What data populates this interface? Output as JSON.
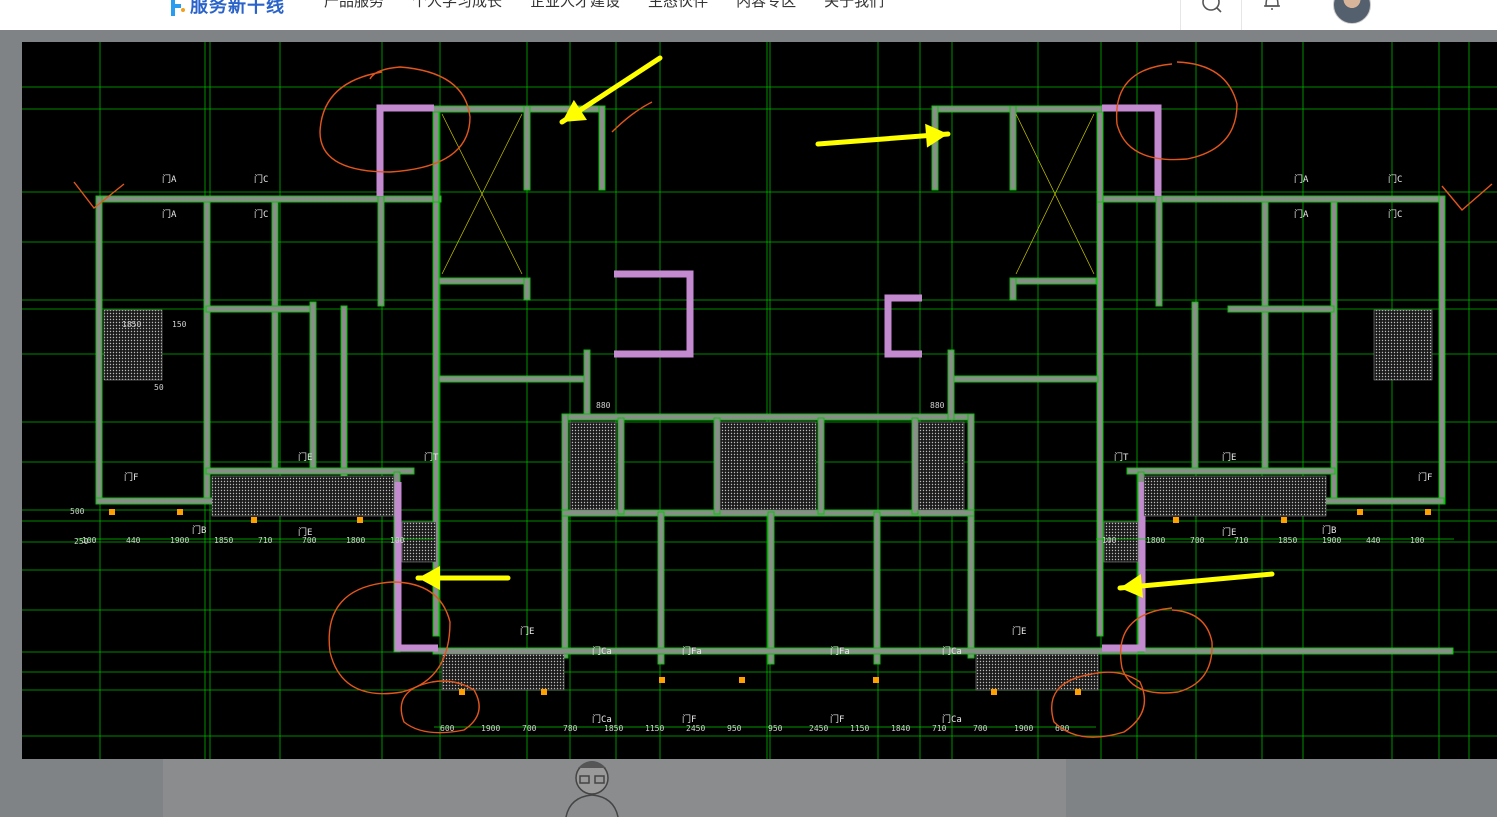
{
  "header": {
    "logo_text": "服务新干线",
    "menu": [
      "产品服务",
      "个人学习成长",
      "企业人才建设",
      "生态伙伴",
      "内容专区",
      "关于我们"
    ],
    "search_icon": "search-icon",
    "bell_icon": "notification-bell-icon"
  },
  "drawing": {
    "room_labels": [
      "门A",
      "门C",
      "门A",
      "门C",
      "门A",
      "门C",
      "门A",
      "门C",
      "门T",
      "门T",
      "门F",
      "门F",
      "门E",
      "门E",
      "门B",
      "门B",
      "门E",
      "门E",
      "门Ca",
      "门Ca",
      "门Fa",
      "门Fa",
      "门Ca",
      "门Ca",
      "门E",
      "门E",
      "门F",
      "门F"
    ],
    "dimensions_left": [
      "100",
      "440",
      "1900",
      "1850",
      "710",
      "700",
      "1800",
      "100"
    ],
    "dimensions_right": [
      "100",
      "1800",
      "700",
      "710",
      "1850",
      "1900",
      "440",
      "100"
    ],
    "dimensions_bottom": [
      "600",
      "1900",
      "700",
      "780",
      "1850",
      "1150",
      "2450",
      "950",
      "950",
      "2450",
      "1150",
      "1840",
      "710",
      "700",
      "1900",
      "600"
    ],
    "side_dims": [
      "1850",
      "150",
      "50",
      "500",
      "250",
      "880",
      "880"
    ],
    "colors": {
      "axis": "#00c800",
      "wall": "#5c9a5a",
      "wall_fill": "#8c8c8c",
      "purple_wall": "#c48ad0",
      "arrow": "#ffff00",
      "circle": "#e2561c"
    }
  }
}
